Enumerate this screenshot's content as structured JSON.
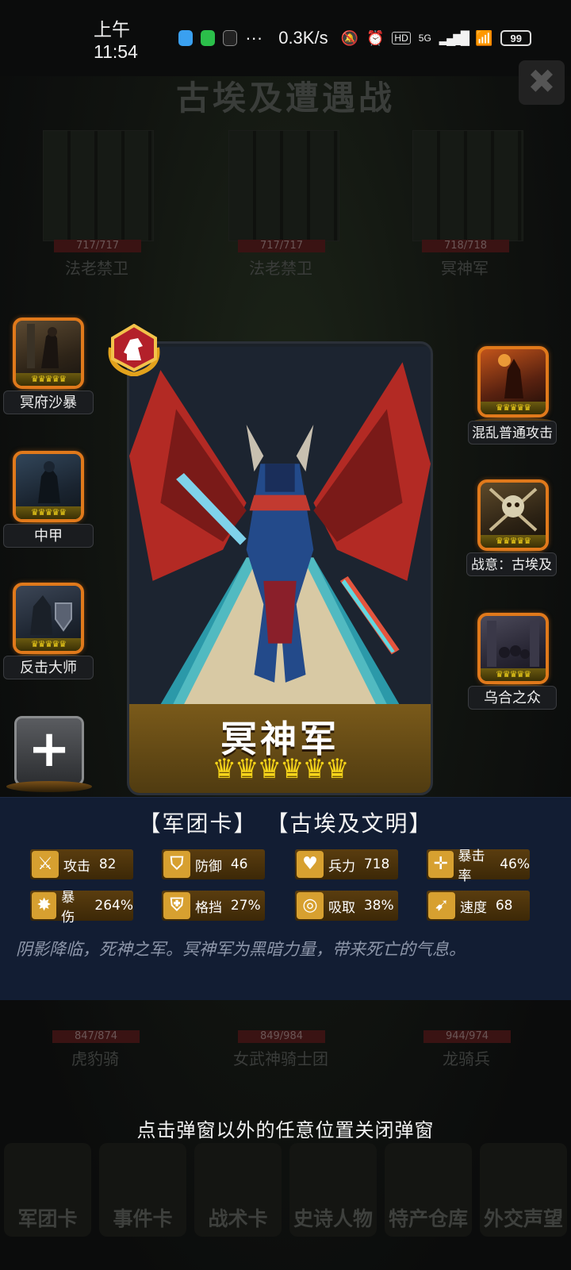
{
  "status_bar": {
    "time": "上午11:54",
    "more": "···",
    "net_speed": "0.3K/s",
    "signal_label": "5G",
    "hd_label": "HD",
    "battery": "99"
  },
  "background": {
    "title": "古埃及遭遇战",
    "close": "✖",
    "enemy_squads": [
      {
        "hp": "717/717",
        "name": "法老禁卫"
      },
      {
        "hp": "717/717",
        "name": "法老禁卫"
      },
      {
        "hp": "718/718",
        "name": "冥神军"
      }
    ],
    "ally_squads": [
      {
        "hp": "847/874",
        "name": "虎豹骑"
      },
      {
        "hp": "849/984",
        "name": "女武神骑士团"
      },
      {
        "hp": "944/974",
        "name": "龙骑兵"
      }
    ],
    "bottom_nav": [
      "军团卡",
      "事件卡",
      "战术卡",
      "史诗人物",
      "特产仓库",
      "外交声望"
    ]
  },
  "left_skills": [
    {
      "label": "冥府沙暴",
      "icon": "desert-warrior-icon"
    },
    {
      "label": "中甲",
      "icon": "armored-warrior-icon"
    },
    {
      "label": "反击大师",
      "icon": "shield-knight-icon"
    }
  ],
  "right_skills": [
    {
      "label": "混乱普通攻击",
      "icon": "fire-warrior-icon"
    },
    {
      "label": "战意：古埃及",
      "icon": "skull-icon"
    },
    {
      "label": "乌合之众",
      "icon": "crowd-icon"
    }
  ],
  "crowns": "♛♛♛♛♛",
  "add_button": "+",
  "card": {
    "name": "冥神军",
    "crowns": "♛♛♛♛♛♛",
    "rank_icon": "knight-chess-icon"
  },
  "panel": {
    "tag_type": "【军团卡】",
    "tag_civ": "【古埃及文明】",
    "stats": [
      {
        "icon": "sword-icon",
        "label": "攻击",
        "value": "82"
      },
      {
        "icon": "shield-icon",
        "label": "防御",
        "value": "46"
      },
      {
        "icon": "heart-icon",
        "label": "兵力",
        "value": "718"
      },
      {
        "icon": "crosshair-icon",
        "label": "暴击率",
        "value": "46%"
      },
      {
        "icon": "burst-icon",
        "label": "暴伤",
        "value": "264%"
      },
      {
        "icon": "block-icon",
        "label": "格挡",
        "value": "27%"
      },
      {
        "icon": "absorb-icon",
        "label": "吸取",
        "value": "38%"
      },
      {
        "icon": "boot-icon",
        "label": "速度",
        "value": "68"
      }
    ],
    "description": "阴影降临，死神之军。冥神军为黑暗力量，带来死亡的气息。"
  },
  "close_hint": "点击弹窗以外的任意位置关闭弹窗"
}
